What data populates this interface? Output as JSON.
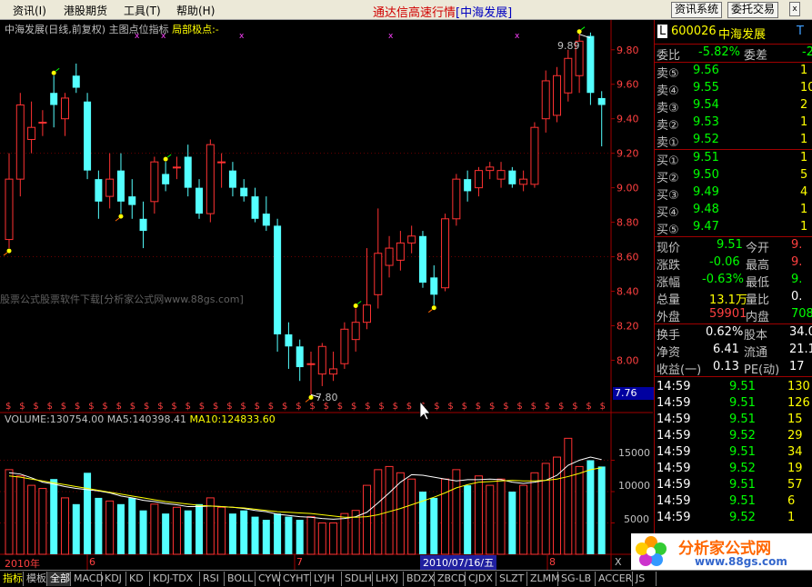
{
  "menu": [
    "资讯(I)",
    "港股期货",
    "工具(T)",
    "帮助(H)"
  ],
  "app_title": "通达信高速行情",
  "app_title_stock": "[中海发展]",
  "menu_buttons": [
    "资讯系统",
    "委托交易"
  ],
  "chart_header": {
    "name": "中海发展(日线,前复权)",
    "indicator": "主图点位指标",
    "indicator_label": "局部极点:-"
  },
  "price_labels": {
    "high": "9.89",
    "low": "7.80"
  },
  "watermark": "股票公式股票软件下载[分析家公式网www.88gs.com]",
  "current_price_box": "7.76",
  "volume_header": {
    "vol": "VOLUME:130754.00",
    "ma5": "MA5:140398.41",
    "ma10": "MA10:124833.60"
  },
  "x_labels": [
    "2010年",
    "6",
    "7",
    "2010/07/16/五",
    "8"
  ],
  "volume_scale": [
    "15000",
    "10000",
    "5000"
  ],
  "x_button": "X",
  "chart_data": {
    "type": "candlestick",
    "price_ylim": [
      7.76,
      9.92
    ],
    "price_ticks": [
      "9.80",
      "9.60",
      "9.40",
      "9.20",
      "9.00",
      "8.80",
      "8.60",
      "8.40",
      "8.20",
      "8.00"
    ],
    "volume_ylim": [
      0,
      20000
    ],
    "candles": [
      {
        "o": 8.7,
        "h": 9.2,
        "l": 8.65,
        "c": 9.05
      },
      {
        "o": 9.05,
        "h": 9.55,
        "l": 8.95,
        "c": 9.48
      },
      {
        "o": 9.28,
        "h": 9.5,
        "l": 9.2,
        "c": 9.35
      },
      {
        "o": 9.38,
        "h": 9.45,
        "l": 9.3,
        "c": 9.38
      },
      {
        "o": 9.55,
        "h": 9.65,
        "l": 9.35,
        "c": 9.48
      },
      {
        "o": 9.4,
        "h": 9.55,
        "l": 9.3,
        "c": 9.52
      },
      {
        "o": 9.65,
        "h": 9.72,
        "l": 9.55,
        "c": 9.58
      },
      {
        "o": 9.5,
        "h": 9.55,
        "l": 9.05,
        "c": 9.1
      },
      {
        "o": 9.05,
        "h": 9.1,
        "l": 8.82,
        "c": 8.92
      },
      {
        "o": 8.95,
        "h": 9.2,
        "l": 8.88,
        "c": 9.05
      },
      {
        "o": 9.1,
        "h": 9.2,
        "l": 8.85,
        "c": 8.92
      },
      {
        "o": 8.95,
        "h": 9.05,
        "l": 8.82,
        "c": 8.9
      },
      {
        "o": 8.82,
        "h": 8.92,
        "l": 8.65,
        "c": 8.75
      },
      {
        "o": 8.92,
        "h": 9.18,
        "l": 8.85,
        "c": 9.15
      },
      {
        "o": 9.08,
        "h": 9.15,
        "l": 8.98,
        "c": 9.02
      },
      {
        "o": 9.12,
        "h": 9.18,
        "l": 9.05,
        "c": 9.12
      },
      {
        "o": 9.18,
        "h": 9.25,
        "l": 8.95,
        "c": 9.0
      },
      {
        "o": 9.0,
        "h": 9.05,
        "l": 8.82,
        "c": 8.85
      },
      {
        "o": 8.85,
        "h": 9.28,
        "l": 8.8,
        "c": 9.25
      },
      {
        "o": 9.15,
        "h": 9.2,
        "l": 9.0,
        "c": 9.15
      },
      {
        "o": 9.1,
        "h": 9.15,
        "l": 8.95,
        "c": 9.0
      },
      {
        "o": 9.0,
        "h": 9.05,
        "l": 8.92,
        "c": 8.95
      },
      {
        "o": 8.95,
        "h": 9.0,
        "l": 8.8,
        "c": 8.82
      },
      {
        "o": 8.85,
        "h": 8.95,
        "l": 8.75,
        "c": 8.78
      },
      {
        "o": 8.78,
        "h": 8.82,
        "l": 8.05,
        "c": 8.15
      },
      {
        "o": 8.15,
        "h": 8.22,
        "l": 7.95,
        "c": 8.08
      },
      {
        "o": 8.08,
        "h": 8.12,
        "l": 7.88,
        "c": 7.96
      },
      {
        "o": 7.98,
        "h": 8.05,
        "l": 7.8,
        "c": 7.98
      },
      {
        "o": 7.92,
        "h": 8.1,
        "l": 7.85,
        "c": 8.08
      },
      {
        "o": 7.92,
        "h": 8.05,
        "l": 7.88,
        "c": 7.95
      },
      {
        "o": 7.98,
        "h": 8.22,
        "l": 7.95,
        "c": 8.18
      },
      {
        "o": 8.12,
        "h": 8.3,
        "l": 8.05,
        "c": 8.22
      },
      {
        "o": 8.22,
        "h": 8.65,
        "l": 8.18,
        "c": 8.32
      },
      {
        "o": 8.38,
        "h": 8.88,
        "l": 8.3,
        "c": 8.62
      },
      {
        "o": 8.55,
        "h": 8.72,
        "l": 8.48,
        "c": 8.65
      },
      {
        "o": 8.58,
        "h": 8.75,
        "l": 8.52,
        "c": 8.68
      },
      {
        "o": 8.68,
        "h": 8.78,
        "l": 8.62,
        "c": 8.72
      },
      {
        "o": 8.72,
        "h": 8.75,
        "l": 8.42,
        "c": 8.45
      },
      {
        "o": 8.48,
        "h": 8.55,
        "l": 8.32,
        "c": 8.38
      },
      {
        "o": 8.42,
        "h": 8.85,
        "l": 8.4,
        "c": 8.82
      },
      {
        "o": 8.82,
        "h": 9.08,
        "l": 8.78,
        "c": 9.05
      },
      {
        "o": 9.05,
        "h": 9.1,
        "l": 8.92,
        "c": 8.98
      },
      {
        "o": 9.0,
        "h": 9.12,
        "l": 8.95,
        "c": 9.1
      },
      {
        "o": 9.1,
        "h": 9.15,
        "l": 9.05,
        "c": 9.12
      },
      {
        "o": 9.05,
        "h": 9.15,
        "l": 9.0,
        "c": 9.1
      },
      {
        "o": 9.1,
        "h": 9.12,
        "l": 9.0,
        "c": 9.02
      },
      {
        "o": 9.02,
        "h": 9.1,
        "l": 8.98,
        "c": 9.05
      },
      {
        "o": 9.02,
        "h": 9.38,
        "l": 9.0,
        "c": 9.35
      },
      {
        "o": 9.4,
        "h": 9.68,
        "l": 9.32,
        "c": 9.62
      },
      {
        "o": 9.42,
        "h": 9.7,
        "l": 9.38,
        "c": 9.65
      },
      {
        "o": 9.55,
        "h": 9.8,
        "l": 9.5,
        "c": 9.75
      },
      {
        "o": 9.65,
        "h": 9.89,
        "l": 9.55,
        "c": 9.85
      },
      {
        "o": 9.88,
        "h": 9.9,
        "l": 9.48,
        "c": 9.55
      },
      {
        "o": 9.52,
        "h": 9.56,
        "l": 9.24,
        "c": 9.48
      }
    ],
    "volume": [
      13500,
      12500,
      11000,
      10500,
      12000,
      9000,
      8000,
      13000,
      9000,
      8500,
      8000,
      9000,
      7000,
      8000,
      6500,
      7500,
      7000,
      8000,
      9000,
      7500,
      6500,
      7000,
      6000,
      5500,
      6500,
      6000,
      5500,
      6000,
      5000,
      5000,
      6500,
      7000,
      11000,
      13500,
      14000,
      13000,
      12000,
      10000,
      9000,
      12000,
      13500,
      11000,
      12500,
      11000,
      12000,
      10000,
      11000,
      13000,
      14500,
      15500,
      18500,
      14000,
      15000,
      14000
    ],
    "ma5": [
      13000,
      12800,
      12200,
      11500,
      11200,
      10800,
      10500,
      10300,
      10100,
      9800,
      9300,
      9000,
      8600,
      8400,
      8100,
      7900,
      7600,
      7600,
      7700,
      7600,
      7500,
      7300,
      7000,
      6800,
      6400,
      6200,
      6000,
      5900,
      5700,
      5600,
      5700,
      6000,
      6700,
      8200,
      9800,
      11500,
      12700,
      12600,
      12300,
      12000,
      11700,
      11900,
      11900,
      12000,
      11900,
      11500,
      11300,
      11500,
      11800,
      12600,
      14200,
      15000,
      15500,
      15100
    ],
    "ma10": [
      12500,
      12300,
      12000,
      11700,
      11400,
      11100,
      10800,
      10500,
      10200,
      9900,
      9600,
      9300,
      9000,
      8700,
      8400,
      8200,
      8000,
      7800,
      7700,
      7600,
      7500,
      7400,
      7200,
      7000,
      6800,
      6700,
      6600,
      6500,
      6300,
      6100,
      5900,
      5900,
      6000,
      6300,
      6800,
      7300,
      7900,
      8500,
      9100,
      9800,
      10600,
      11100,
      11500,
      11600,
      11700,
      11800,
      11700,
      11700,
      11800,
      12000,
      12400,
      12900,
      13500,
      13800
    ],
    "high_marker_indices": [
      4,
      14,
      31,
      51
    ],
    "low_marker_indices": [
      0,
      10,
      27,
      38
    ]
  },
  "quote": {
    "code": "600026",
    "name": "中海发展",
    "t_flag": "T",
    "weibi_label": "委比",
    "weibi": "-5.82%",
    "weicha_label": "委差",
    "weicha": "-2",
    "sell": [
      {
        "label": "卖⑤",
        "price": "9.56",
        "vol": "1"
      },
      {
        "label": "卖④",
        "price": "9.55",
        "vol": "10"
      },
      {
        "label": "卖③",
        "price": "9.54",
        "vol": "2"
      },
      {
        "label": "卖②",
        "price": "9.53",
        "vol": "1"
      },
      {
        "label": "卖①",
        "price": "9.52",
        "vol": "1"
      }
    ],
    "buy": [
      {
        "label": "买①",
        "price": "9.51",
        "vol": "1"
      },
      {
        "label": "买②",
        "price": "9.50",
        "vol": "5"
      },
      {
        "label": "买③",
        "price": "9.49",
        "vol": "4"
      },
      {
        "label": "买④",
        "price": "9.48",
        "vol": "1"
      },
      {
        "label": "买⑤",
        "price": "9.47",
        "vol": "1"
      }
    ],
    "stats": [
      {
        "l1": "现价",
        "v1": "9.51",
        "c1": "#00ff00",
        "l2": "今开",
        "v2": "9.",
        "c2": "#ff4040"
      },
      {
        "l1": "涨跌",
        "v1": "-0.06",
        "c1": "#00ff00",
        "l2": "最高",
        "v2": "9.",
        "c2": "#ff4040"
      },
      {
        "l1": "涨幅",
        "v1": "-0.63%",
        "c1": "#00ff00",
        "l2": "最低",
        "v2": "9.",
        "c2": "#00ff00"
      },
      {
        "l1": "总量",
        "v1": "13.1万",
        "c1": "#ffff00",
        "l2": "量比",
        "v2": "0.",
        "c2": "#ffffff"
      },
      {
        "l1": "外盘",
        "v1": "59901",
        "c1": "#ff4040",
        "l2": "内盘",
        "v2": "708",
        "c2": "#00ff00"
      }
    ],
    "fundamentals": [
      {
        "l1": "换手",
        "v1": "0.62%",
        "l2": "股本",
        "v2": "34.0"
      },
      {
        "l1": "净资",
        "v1": "6.41",
        "l2": "流通",
        "v2": "21.1"
      },
      {
        "l1": "收益(一)",
        "v1": "0.13",
        "l2": "PE(动)",
        "v2": "17"
      }
    ],
    "ticks": [
      {
        "time": "14:59",
        "price": "9.51",
        "vol": "130",
        "pc": "#00ff00"
      },
      {
        "time": "14:59",
        "price": "9.51",
        "vol": "126",
        "pc": "#00ff00"
      },
      {
        "time": "14:59",
        "price": "9.51",
        "vol": "15",
        "pc": "#00ff00"
      },
      {
        "time": "14:59",
        "price": "9.52",
        "vol": "29",
        "pc": "#00ff00"
      },
      {
        "time": "14:59",
        "price": "9.51",
        "vol": "34",
        "pc": "#00ff00"
      },
      {
        "time": "14:59",
        "price": "9.52",
        "vol": "19",
        "pc": "#00ff00"
      },
      {
        "time": "14:59",
        "price": "9.51",
        "vol": "57",
        "pc": "#00ff00"
      },
      {
        "time": "14:59",
        "price": "9.51",
        "vol": "6",
        "pc": "#00ff00"
      },
      {
        "time": "14:59",
        "price": "9.52",
        "vol": "1",
        "pc": "#00ff00"
      }
    ]
  },
  "bottom_tabs": [
    "指标",
    "模板",
    "全部",
    "MACD",
    "KDJ",
    "KD",
    "KDJ-TDX",
    "RSI",
    "BOLL",
    "CYW",
    "CYHT",
    "LYJH",
    "SDLH",
    "LHXJ",
    "BDZX",
    "ZBCD",
    "CJDX",
    "SLZT",
    "ZLMM",
    "SG-LB",
    "ACCER",
    "JS"
  ],
  "logo": {
    "text": "分析家公式网",
    "url": "www.88gs.com"
  },
  "colors": {
    "up": "#ff3232",
    "down": "#54ffff",
    "ma5": "#ffffff",
    "ma10": "#ffff00",
    "grid": "#a00000"
  }
}
